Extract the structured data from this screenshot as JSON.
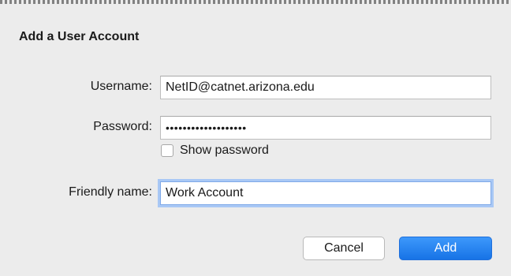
{
  "dialog": {
    "title": "Add a User Account",
    "username": {
      "label": "Username:",
      "value": "NetID@catnet.arizona.edu"
    },
    "password": {
      "label": "Password:",
      "value": "•••••••••••••••••••"
    },
    "show_password": {
      "label": "Show password",
      "checked": false
    },
    "friendly_name": {
      "label": "Friendly name:",
      "value": "Work Account"
    },
    "buttons": {
      "cancel": "Cancel",
      "add": "Add"
    }
  },
  "colors": {
    "background": "#ececec",
    "accent": "#1773e6",
    "focus_ring": "#a9c8f5"
  }
}
